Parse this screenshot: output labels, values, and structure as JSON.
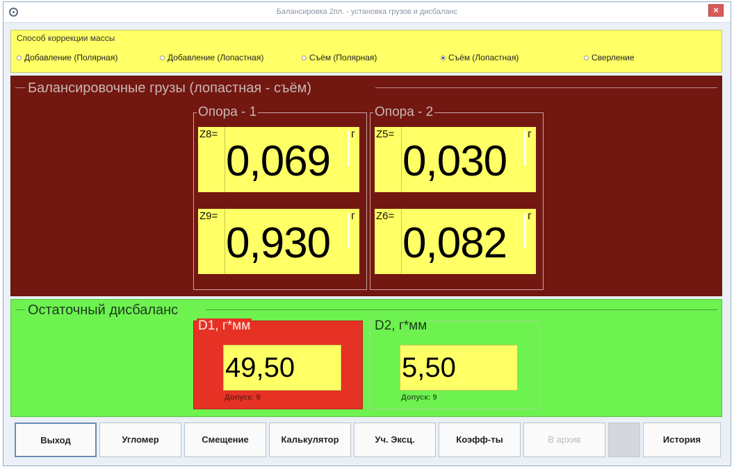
{
  "window": {
    "title": "Балансировка 2пл. - установка грузов и дисбаланс"
  },
  "method": {
    "legend": "Способ коррекции массы",
    "options": [
      {
        "label": "Добавление (Полярная)",
        "checked": false
      },
      {
        "label": "Добавление (Лопастная)",
        "checked": false
      },
      {
        "label": "Съём (Полярная)",
        "checked": false
      },
      {
        "label": "Съём (Лопастная)",
        "checked": true
      },
      {
        "label": "Сверление",
        "checked": false
      }
    ]
  },
  "weights": {
    "legend": "Балансировочные грузы (лопастная - съём)",
    "supports": [
      {
        "legend": "Опора - 1",
        "boxes": [
          {
            "label": "Z8=",
            "value": "0,069",
            "unit": "г"
          },
          {
            "label": "Z9=",
            "value": "0,930",
            "unit": "г"
          }
        ]
      },
      {
        "legend": "Опора - 2",
        "boxes": [
          {
            "label": "Z5=",
            "value": "0,030",
            "unit": "г"
          },
          {
            "label": "Z6=",
            "value": "0,082",
            "unit": "г"
          }
        ]
      }
    ]
  },
  "residual": {
    "legend": "Остаточный дисбаланс",
    "d1": {
      "label": "D1, г*мм",
      "value": "49,50",
      "tolerance": "Допуск:   9",
      "status_color": "#e53225"
    },
    "d2": {
      "label": "D2, г*мм",
      "value": "5,50",
      "tolerance": "Допуск:   9",
      "status_color": "#6ef250"
    }
  },
  "buttons": {
    "exit": "Выход",
    "goniometer": "Угломер",
    "offset": "Смещение",
    "calculator": "Калькулятор",
    "eccentricity": "Уч. Эксц.",
    "coefficients": "Коэфф-ты",
    "archive": "В архив",
    "history": "История"
  }
}
